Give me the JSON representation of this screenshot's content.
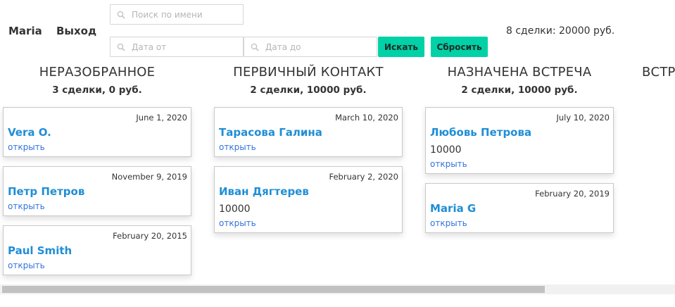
{
  "header": {
    "user_name": "Maria",
    "logout_label": "Выход",
    "search_placeholder": "Поиск по имени",
    "date_from_placeholder": "Дата от",
    "date_to_placeholder": "Дата до",
    "search_button": "Искать",
    "reset_button": "Сбросить",
    "summary": "8 сделки: 20000 руб.",
    "accent_color": "#00d1a6",
    "link_color": "#1f8ed6"
  },
  "columns": [
    {
      "title": "НЕРАЗОБРАННОЕ",
      "subtitle": "3 сделки, 0 руб.",
      "cards": [
        {
          "date": "June 1, 2020",
          "name": "Vera O.",
          "amount": "",
          "open": "открыть"
        },
        {
          "date": "November 9, 2019",
          "name": "Петр Петров",
          "amount": "",
          "open": "открыть"
        },
        {
          "date": "February 20, 2015",
          "name": "Paul Smith",
          "amount": "",
          "open": "открыть"
        }
      ]
    },
    {
      "title": "ПЕРВИЧНЫЙ КОНТАКТ",
      "subtitle": "2 сделки, 10000 руб.",
      "cards": [
        {
          "date": "March 10, 2020",
          "name": "Тарасова Галина",
          "amount": "",
          "open": "открыть"
        },
        {
          "date": "February 2, 2020",
          "name": "Иван Дягтерев",
          "amount": "10000",
          "open": "открыть"
        }
      ]
    },
    {
      "title": "НАЗНАЧЕНА ВСТРЕЧА",
      "subtitle": "2 сделки, 10000 руб.",
      "cards": [
        {
          "date": "July 10, 2020",
          "name": "Любовь Петрова",
          "amount": "10000",
          "open": "открыть"
        },
        {
          "date": "February 20, 2019",
          "name": "Maria G",
          "amount": "",
          "open": "открыть"
        }
      ]
    },
    {
      "title": "ВСТР",
      "subtitle": "",
      "cards": []
    }
  ]
}
